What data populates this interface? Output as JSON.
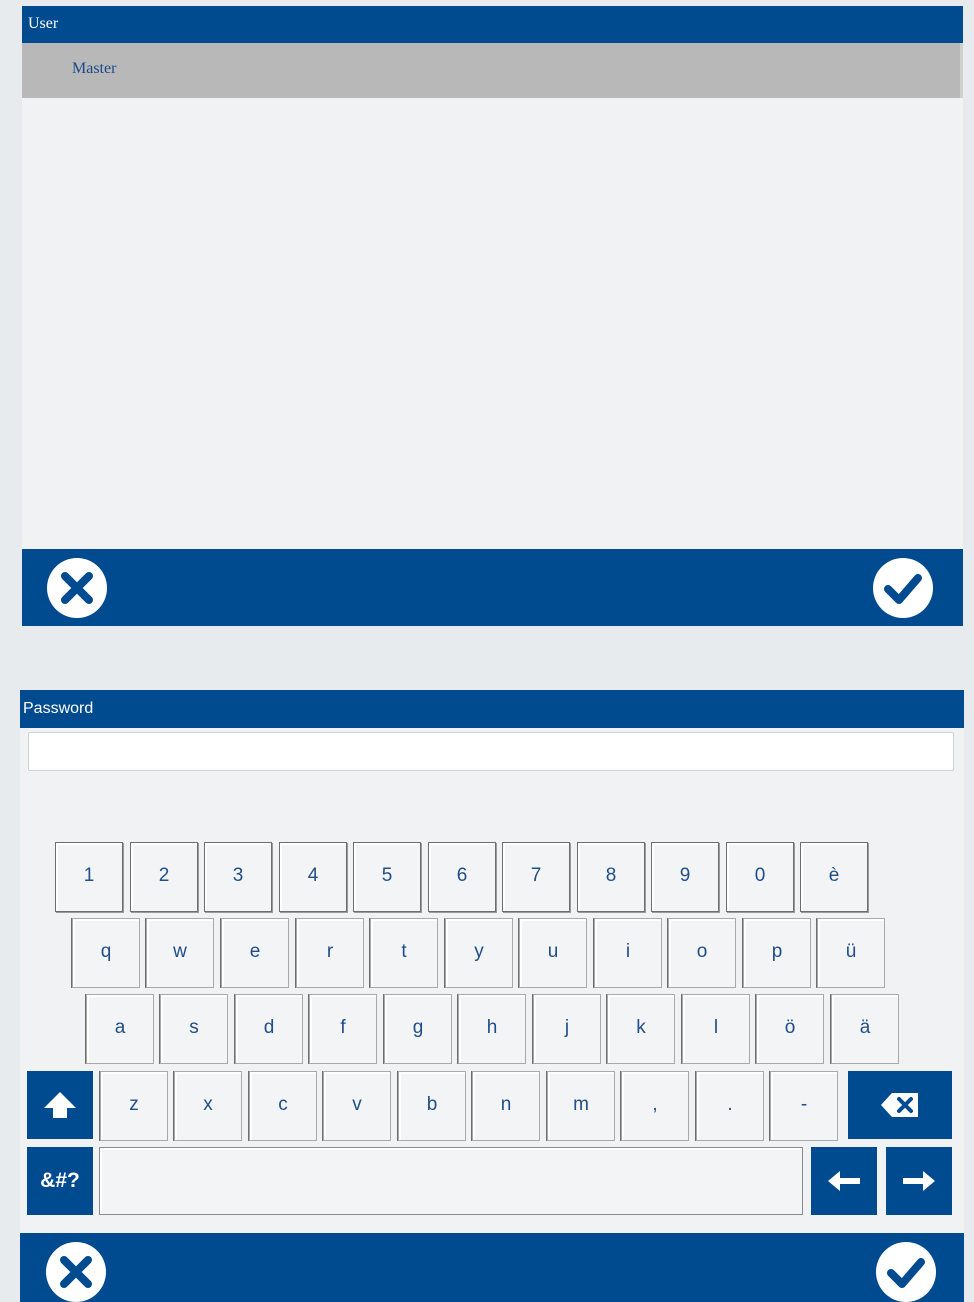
{
  "user_dialog": {
    "title": "User",
    "users": [
      "Master"
    ],
    "footer": {
      "cancel_icon": "close-icon",
      "confirm_icon": "checkmark-icon"
    }
  },
  "password_dialog": {
    "title": "Password",
    "input_value": "",
    "keyboard": {
      "row1": [
        "1",
        "2",
        "3",
        "4",
        "5",
        "6",
        "7",
        "8",
        "9",
        "0",
        "è"
      ],
      "row2": [
        "q",
        "w",
        "e",
        "r",
        "t",
        "y",
        "u",
        "i",
        "o",
        "p",
        "ü"
      ],
      "row3": [
        "a",
        "s",
        "d",
        "f",
        "g",
        "h",
        "j",
        "k",
        "l",
        "ö",
        "ä"
      ],
      "row4": [
        "z",
        "x",
        "c",
        "v",
        "b",
        "n",
        "m",
        ",",
        ".",
        "-"
      ],
      "symbols_label": "&#?",
      "shift_icon": "shift-arrow-up-icon",
      "backspace_icon": "backspace-icon",
      "left_icon": "arrow-left-icon",
      "right_icon": "arrow-right-icon"
    },
    "footer": {
      "cancel_icon": "close-icon",
      "confirm_icon": "checkmark-icon"
    }
  },
  "colors": {
    "primary": "#004a8f",
    "panel": "#f1f2f3",
    "selected_row": "#b8b8b8",
    "key_text": "#1f4e8a"
  }
}
